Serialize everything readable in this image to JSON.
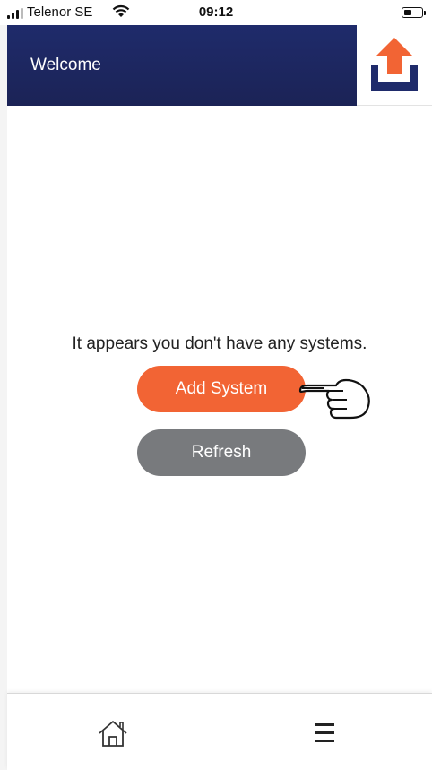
{
  "status_bar": {
    "carrier": "Telenor SE",
    "time": "09:12"
  },
  "header": {
    "title": "Welcome",
    "brand_color": "#1f2b6b",
    "logo_icon": "upload-arrow-icon"
  },
  "main": {
    "empty_message": "It appears you don't have any systems.",
    "add_button_label": "Add System",
    "refresh_button_label": "Refresh",
    "accent_color": "#f26434",
    "secondary_color": "#787a7d",
    "pointer_icon": "pointing-hand-icon"
  },
  "bottom_nav": {
    "items": [
      {
        "icon": "home-icon"
      },
      {
        "icon": "menu-icon"
      }
    ]
  }
}
